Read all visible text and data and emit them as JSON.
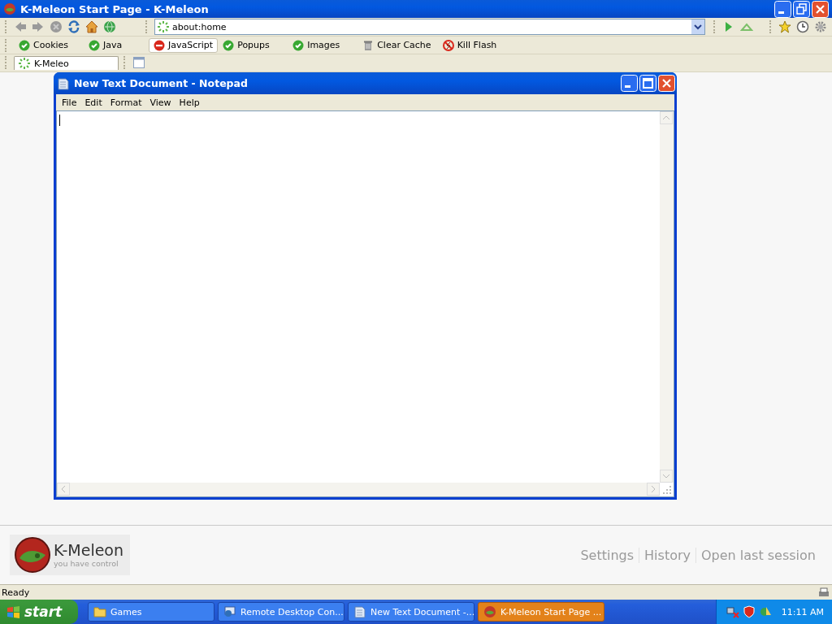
{
  "browser": {
    "title": "K-Meleon Start Page - K-Meleon",
    "address": "about:home",
    "toolbar": [
      {
        "kind": "toggle",
        "label": "Cookies",
        "enabled": true
      },
      {
        "kind": "toggle",
        "label": "Java",
        "enabled": true
      },
      {
        "kind": "toggle",
        "label": "JavaScript",
        "enabled": false
      },
      {
        "kind": "toggle",
        "label": "Popups",
        "enabled": true
      },
      {
        "kind": "toggle",
        "label": "Images",
        "enabled": true
      },
      {
        "kind": "cache",
        "label": "Clear Cache"
      },
      {
        "kind": "flash",
        "label": "Kill Flash"
      }
    ],
    "tabs": [
      {
        "label": "K-Meleo",
        "selected": true
      }
    ],
    "start_page": {
      "logo_name": "K-Meleon",
      "logo_tagline": "you have control",
      "links": [
        "Settings",
        "History",
        "Open last session"
      ]
    },
    "status": "Ready"
  },
  "notepad": {
    "title": "New Text Document - Notepad",
    "menu": [
      "File",
      "Edit",
      "Format",
      "View",
      "Help"
    ]
  },
  "taskbar": {
    "start": "start",
    "tasks": [
      {
        "label": "Games",
        "selected": false
      },
      {
        "label": "Remote Desktop Con...",
        "selected": false
      },
      {
        "label": "New Text Document -...",
        "selected": false
      },
      {
        "label": "K-Meleon Start Page ...",
        "selected": true
      }
    ],
    "clock": "11:11 AM"
  }
}
